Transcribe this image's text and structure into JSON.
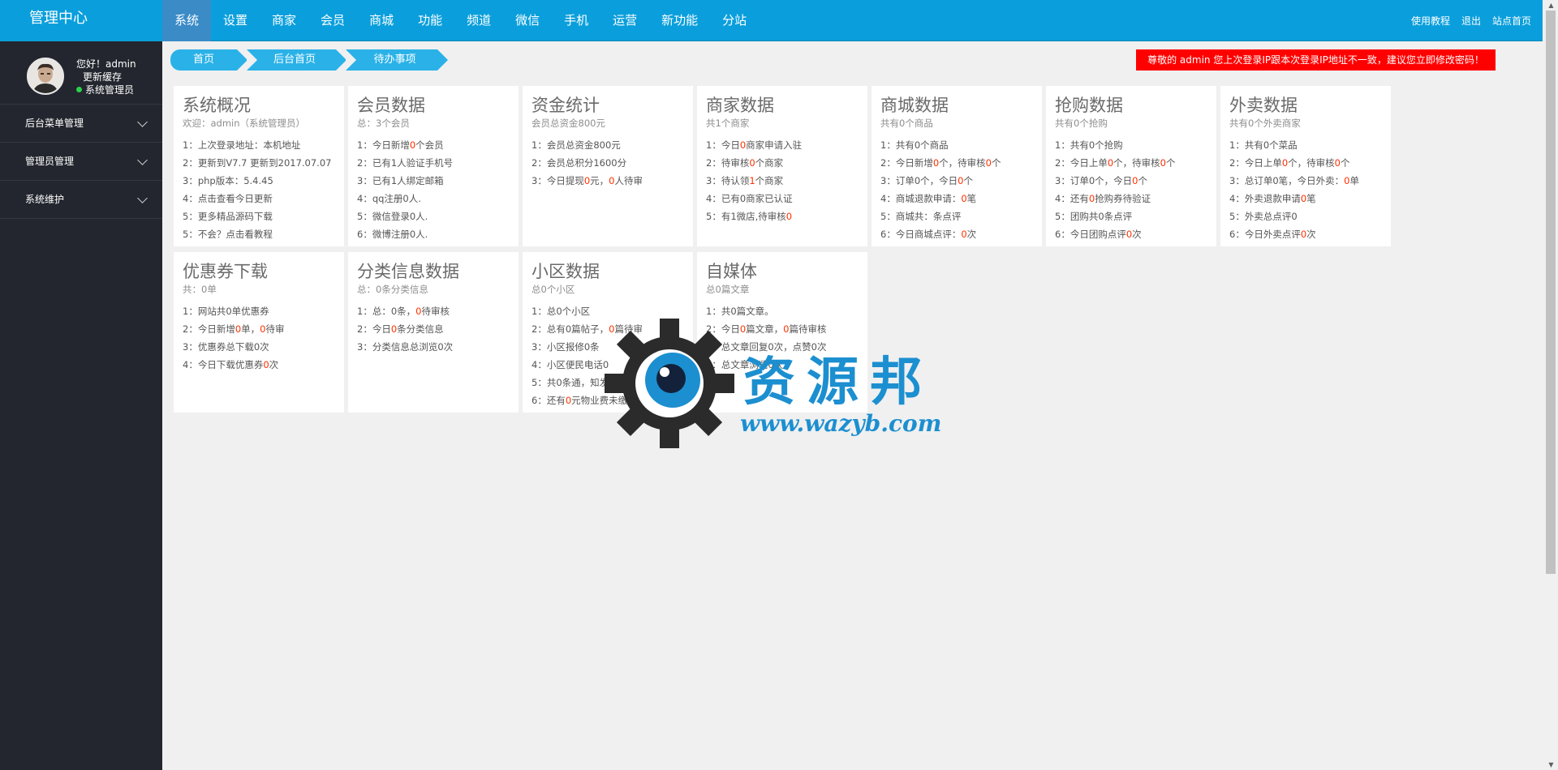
{
  "app": {
    "title": "管理中心"
  },
  "nav": [
    "系统",
    "设置",
    "商家",
    "会员",
    "商城",
    "功能",
    "频道",
    "微信",
    "手机",
    "运营",
    "新功能",
    "分站"
  ],
  "top_links": [
    "使用教程",
    "退出",
    "站点首页"
  ],
  "user": {
    "greeting": "您好！admin",
    "refresh_cache": "更新缓存",
    "role": "系统管理员"
  },
  "sidebar_menu": [
    "后台菜单管理",
    "管理员管理",
    "系统维护"
  ],
  "breadcrumb": [
    "首页",
    "后台首页",
    "待办事项"
  ],
  "alert": "尊敬的 admin 您上次登录IP跟本次登录IP地址不一致，建议您立即修改密码！",
  "cards": [
    {
      "title": "系统概况",
      "sub": "欢迎：admin（系统管理员）",
      "lines": [
        [
          [
            "1：上次登录地址：本机地址",
            ""
          ]
        ],
        [
          [
            "2：更新到V7.7 更新到2017.07.07",
            ""
          ]
        ],
        [
          [
            "3：php版本：5.4.45",
            ""
          ]
        ],
        [
          [
            "4：点击查看今日更新",
            ""
          ]
        ],
        [
          [
            "5：更多精品源码下载",
            ""
          ]
        ],
        [
          [
            "5：不会？点击看教程",
            ""
          ]
        ]
      ]
    },
    {
      "title": "会员数据",
      "sub": "总：3个会员",
      "lines": [
        [
          [
            "1：今日新增",
            ""
          ],
          [
            "0",
            "r"
          ],
          [
            "个会员",
            ""
          ]
        ],
        [
          [
            "2：已有1人验证手机号",
            ""
          ]
        ],
        [
          [
            "3：已有1人绑定邮箱",
            ""
          ]
        ],
        [
          [
            "4：qq注册0人.",
            ""
          ]
        ],
        [
          [
            "5：微信登录0人.",
            ""
          ]
        ],
        [
          [
            "6：微博注册0人.",
            ""
          ]
        ]
      ]
    },
    {
      "title": "资金统计",
      "sub": "会员总资金800元",
      "lines": [
        [
          [
            "1：会员总资金800元",
            ""
          ]
        ],
        [
          [
            "2：会员总积分1600分",
            ""
          ]
        ],
        [
          [
            "3：今日提现",
            ""
          ],
          [
            "0",
            "r"
          ],
          [
            "元，",
            ""
          ],
          [
            "0",
            "r"
          ],
          [
            "人待审",
            ""
          ]
        ]
      ]
    },
    {
      "title": "商家数据",
      "sub": "共1个商家",
      "lines": [
        [
          [
            "1：今日",
            ""
          ],
          [
            "0",
            "r"
          ],
          [
            "商家申请入驻",
            ""
          ]
        ],
        [
          [
            "2：待审核",
            ""
          ],
          [
            "0",
            "r"
          ],
          [
            "个商家",
            ""
          ]
        ],
        [
          [
            "3：待认领",
            ""
          ],
          [
            "1",
            "r"
          ],
          [
            "个商家",
            ""
          ]
        ],
        [
          [
            "4：已有0商家已认证",
            ""
          ]
        ],
        [
          [
            "5：有1微店,待审核",
            ""
          ],
          [
            "0",
            "r"
          ]
        ]
      ]
    },
    {
      "title": "商城数据",
      "sub": "共有0个商品",
      "lines": [
        [
          [
            "1：共有0个商品",
            ""
          ]
        ],
        [
          [
            "2：今日新增",
            ""
          ],
          [
            "0",
            "r"
          ],
          [
            "个，待审核",
            ""
          ],
          [
            "0",
            "r"
          ],
          [
            "个",
            ""
          ]
        ],
        [
          [
            "3：订单0个，今日",
            ""
          ],
          [
            "0",
            "r"
          ],
          [
            "个",
            ""
          ]
        ],
        [
          [
            "4：商城退款申请：",
            ""
          ],
          [
            "0",
            "r"
          ],
          [
            "笔",
            ""
          ]
        ],
        [
          [
            "5：商城共：条点评",
            ""
          ]
        ],
        [
          [
            "6：今日商城点评：",
            ""
          ],
          [
            "0",
            "r"
          ],
          [
            "次",
            ""
          ]
        ]
      ]
    },
    {
      "title": "抢购数据",
      "sub": "共有0个抢购",
      "lines": [
        [
          [
            "1：共有0个抢购",
            ""
          ]
        ],
        [
          [
            "2：今日上单",
            ""
          ],
          [
            "0",
            "r"
          ],
          [
            "个，待审核",
            ""
          ],
          [
            "0",
            "r"
          ],
          [
            "个",
            ""
          ]
        ],
        [
          [
            "3：订单0个，今日",
            ""
          ],
          [
            "0",
            "r"
          ],
          [
            "个",
            ""
          ]
        ],
        [
          [
            "4：还有",
            ""
          ],
          [
            "0",
            "r"
          ],
          [
            "抢购券待验证",
            ""
          ]
        ],
        [
          [
            "5：团购共0条点评",
            ""
          ]
        ],
        [
          [
            "6：今日团购点评",
            ""
          ],
          [
            "0",
            "r"
          ],
          [
            "次",
            ""
          ]
        ]
      ]
    },
    {
      "title": "外卖数据",
      "sub": "共有0个外卖商家",
      "lines": [
        [
          [
            "1：共有0个菜品",
            ""
          ]
        ],
        [
          [
            "2：今日上单",
            ""
          ],
          [
            "0",
            "r"
          ],
          [
            "个，待审核",
            ""
          ],
          [
            "0",
            "r"
          ],
          [
            "个",
            ""
          ]
        ],
        [
          [
            "3：总订单0笔，今日外卖：",
            ""
          ],
          [
            "0",
            "r"
          ],
          [
            "单",
            ""
          ]
        ],
        [
          [
            "4：外卖退款申请",
            ""
          ],
          [
            "0",
            "r"
          ],
          [
            "笔",
            ""
          ]
        ],
        [
          [
            "5：外卖总点评0",
            ""
          ]
        ],
        [
          [
            "6：今日外卖点评",
            ""
          ],
          [
            "0",
            "r"
          ],
          [
            "次",
            ""
          ]
        ]
      ]
    },
    {
      "title": "优惠券下载",
      "sub": "共：0单",
      "lines": [
        [
          [
            "1：网站共0单优惠券",
            ""
          ]
        ],
        [
          [
            "2：今日新增",
            ""
          ],
          [
            "0",
            "r"
          ],
          [
            "单，",
            ""
          ],
          [
            "0",
            "r"
          ],
          [
            "待审",
            ""
          ]
        ],
        [
          [
            "3：优惠券总下载0次",
            ""
          ]
        ],
        [
          [
            "4：今日下载优惠券",
            ""
          ],
          [
            "0",
            "r"
          ],
          [
            "次",
            ""
          ]
        ]
      ]
    },
    {
      "title": "分类信息数据",
      "sub": "总：0条分类信息",
      "lines": [
        [
          [
            "1：总：0条，",
            ""
          ],
          [
            "0",
            "r"
          ],
          [
            "待审核",
            ""
          ]
        ],
        [
          [
            "2：今日",
            ""
          ],
          [
            "0",
            "r"
          ],
          [
            "条分类信息",
            ""
          ]
        ],
        [
          [
            "3：分类信息总浏览0次",
            ""
          ]
        ]
      ]
    },
    {
      "title": "小区数据",
      "sub": "总0个小区",
      "lines": [
        [
          [
            "1：总0个小区",
            ""
          ]
        ],
        [
          [
            "2：总有0篇帖子，",
            ""
          ],
          [
            "0",
            "r"
          ],
          [
            "篇待审",
            ""
          ]
        ],
        [
          [
            "3：小区报修0条",
            ""
          ]
        ],
        [
          [
            "4：小区便民电话0",
            ""
          ]
        ],
        [
          [
            "5：共0条通，知",
            ""
          ],
          [
            "",
            ""
          ],
          [
            "发送0",
            ""
          ]
        ],
        [
          [
            "6：还有",
            ""
          ],
          [
            "0",
            "r"
          ],
          [
            "元物业费未缴",
            ""
          ]
        ]
      ]
    },
    {
      "title": "自媒体",
      "sub": "总0篇文章",
      "lines": [
        [
          [
            "1：共0篇文章。",
            ""
          ]
        ],
        [
          [
            "2：今日",
            ""
          ],
          [
            "0",
            "r"
          ],
          [
            "篇文章，",
            ""
          ],
          [
            "0",
            "r"
          ],
          [
            "篇待审核",
            ""
          ]
        ],
        [
          [
            "3：总文章回复0次，点赞0次",
            ""
          ]
        ],
        [
          [
            "4：总文章浏览0次",
            ""
          ]
        ]
      ]
    }
  ],
  "watermark": {
    "text": "资源邦",
    "url": "www.wazyb.com"
  },
  "colors": {
    "topbar": "#0a9fdc",
    "sidebar": "#23262e",
    "alert": "#ff0000",
    "accent": "#2ab2e8",
    "highlight": "#ff3000"
  }
}
